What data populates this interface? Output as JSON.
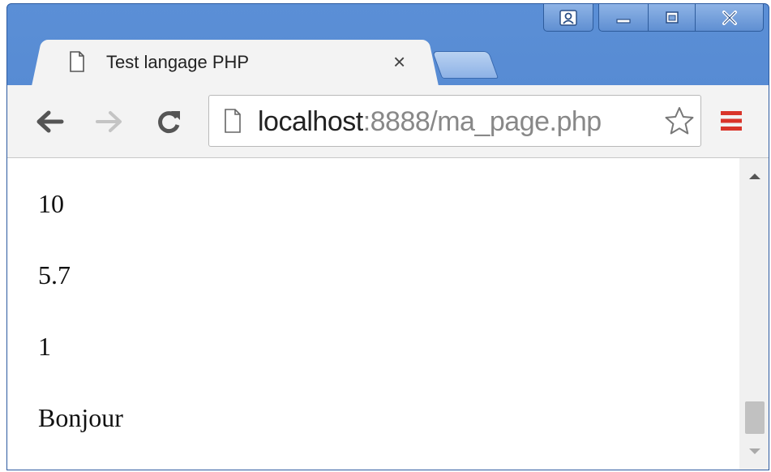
{
  "window": {
    "caption_buttons": [
      "user-icon",
      "minimize-icon",
      "maximize-icon",
      "close-icon"
    ]
  },
  "tab": {
    "title": "Test langage PHP",
    "close_label": "×"
  },
  "toolbar": {
    "url_host": "localhost",
    "url_rest": ":8888/ma_page.php"
  },
  "content": {
    "lines": [
      "10",
      "5.7",
      "1",
      "Bonjour"
    ]
  },
  "colors": {
    "frame": "#4a7fcb",
    "menu_accent": "#d9352b"
  }
}
